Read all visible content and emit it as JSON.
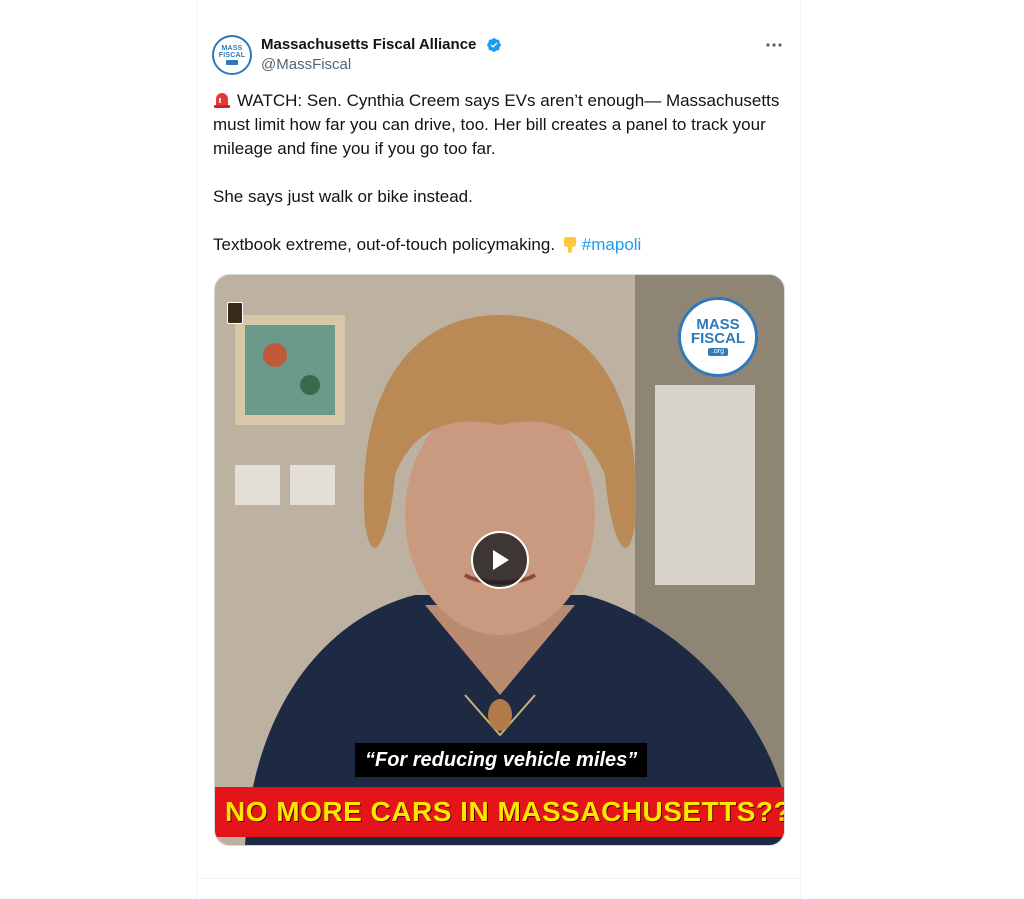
{
  "account": {
    "display_name": "Massachusetts Fiscal Alliance",
    "handle": "@MassFiscal",
    "avatar_lines": [
      "MASS",
      "FISCAL"
    ],
    "verified": true
  },
  "tweet": {
    "line1": "WATCH: Sen. Cynthia Creem says EVs aren’t enough— Massachusetts must limit how far you can drive, too. Her bill creates a panel to track your mileage and fine you if you go too far.",
    "line2": "She says just walk or bike instead.",
    "line3": "Textbook extreme, out-of-touch policymaking.",
    "hashtag": "#mapoli",
    "emoji_icons": [
      "siren-icon",
      "pointing-down-icon"
    ]
  },
  "media": {
    "logo_lines": [
      "MASS",
      "FISCAL"
    ],
    "logo_org": ".org",
    "caption": "“For reducing vehicle miles”",
    "banner": "NO MORE CARS IN MASSACHUSETTS???"
  },
  "colors": {
    "accent": "#1d9bf0",
    "text": "#0f1419",
    "muted": "#536471",
    "banner_bg": "#e3141a",
    "banner_text": "#ffe600",
    "brand_blue": "#2f79b9"
  }
}
